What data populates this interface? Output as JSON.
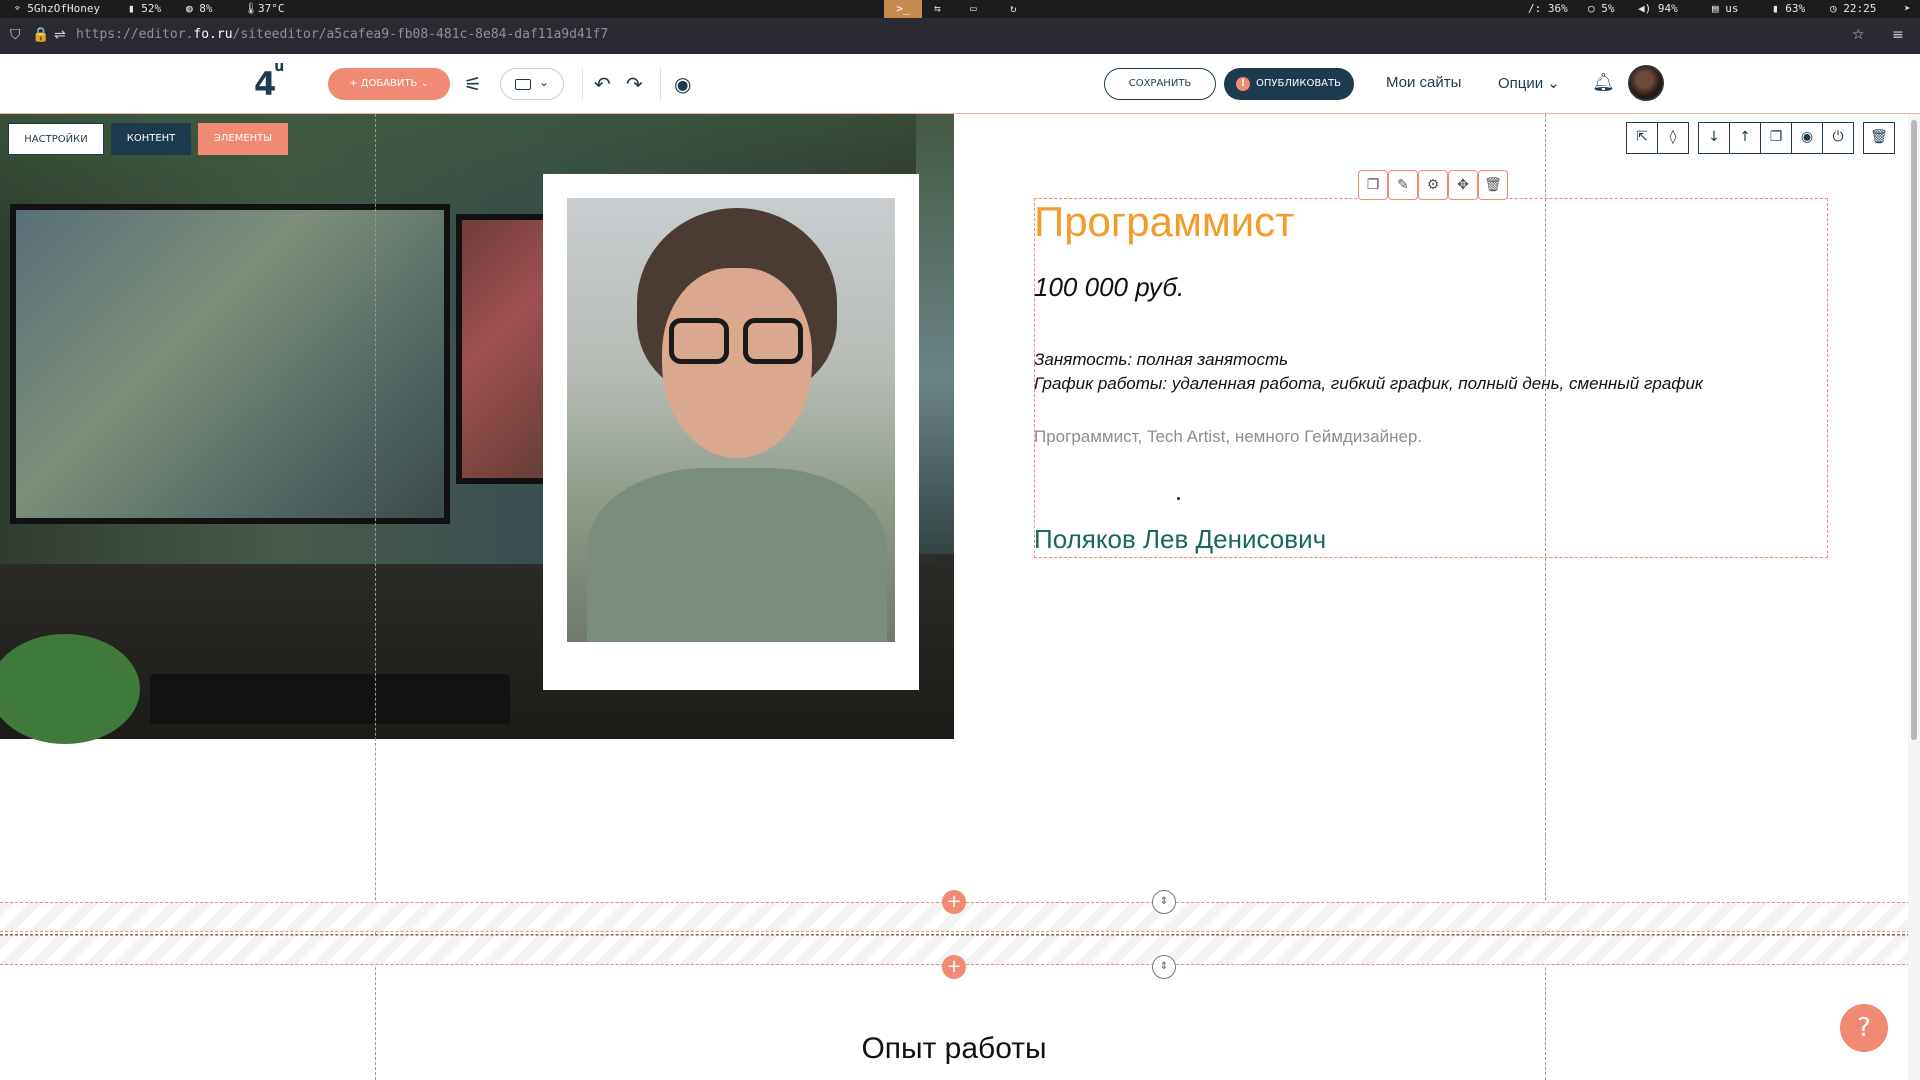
{
  "statusbar": {
    "wifi": "5GhzOfHoney",
    "battery1": "52%",
    "cpu": "8%",
    "temp": "37°C",
    "terminal": ">_",
    "disk": "/: 36%",
    "mem": "5%",
    "volume": "94%",
    "keyboard": "us",
    "battery2": "63%",
    "time": "22:25"
  },
  "browser": {
    "url_prefix": "https://editor.",
    "url_host": "fo.ru",
    "url_rest": "/siteeditor/a5cafea9-fb08-481c-8e84-daf11a9d41f7"
  },
  "toolbar": {
    "logo": "4",
    "logo_sup": "u",
    "add_label": "+ Добавить",
    "save_label": "Сохранить",
    "publish_label": "Опубликовать",
    "publish_warn": "!",
    "my_sites": "Мои сайты",
    "options": "Опции"
  },
  "tabs": {
    "settings": "Настройки",
    "content": "Контент",
    "elements": "Элементы"
  },
  "resume": {
    "title": "Программист",
    "salary": "100 000 руб.",
    "employment": "Занятость: полная занятость",
    "schedule": "График работы: удаленная работа, гибкий график, полный день, сменный график",
    "about": "Программист, Tech Artist, немного Геймдизайнер.",
    "name": "Поляков Лев Денисович"
  },
  "section": {
    "title": "Опыт работы"
  },
  "help_label": "?",
  "colors": {
    "accent": "#f08a72",
    "navy": "#1d3a4e",
    "title_orange": "#f39c2b",
    "name_teal": "#16695b"
  }
}
